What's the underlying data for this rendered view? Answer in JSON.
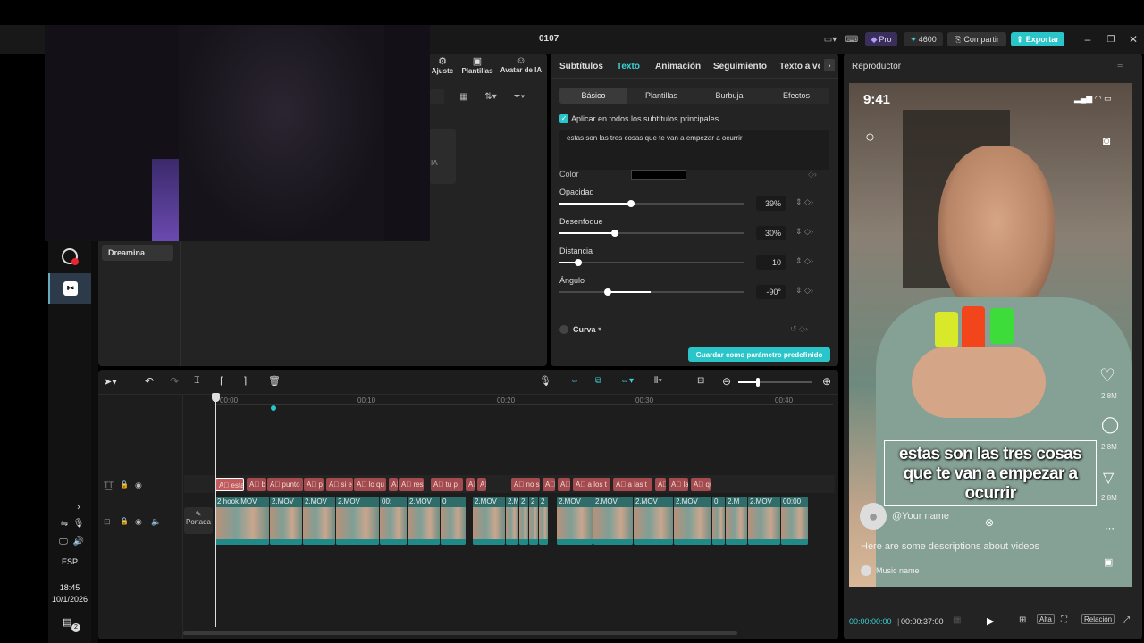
{
  "window": {
    "title": "0107"
  },
  "header": {
    "pro_label": "Pro",
    "credits": "4600",
    "share_label": "Compartir",
    "export_label": "Exportar"
  },
  "left_panel": {
    "toolbar": [
      {
        "label": "Ajuste"
      },
      {
        "label": "Plantillas"
      },
      {
        "label": "Avatar de IA"
      }
    ],
    "category": "Dreamina",
    "ia_tag": "IA"
  },
  "props": {
    "tabs": [
      "Subtítulos",
      "Texto",
      "Animación",
      "Seguimiento",
      "Texto a vo"
    ],
    "active_tab": "Texto",
    "subtabs": [
      "Básico",
      "Plantillas",
      "Burbuja",
      "Efectos"
    ],
    "apply_all_label": "Aplicar en todos los subtítulos principales",
    "text_value": "estas son las tres cosas que te van a empezar a ocurrir",
    "color_label": "Color",
    "opacity": {
      "label": "Opacidad",
      "value": "39%",
      "level": 0.39
    },
    "blur": {
      "label": "Desenfoque",
      "value": "30%",
      "level": 0.3
    },
    "distance": {
      "label": "Distancia",
      "value": "10",
      "level": 0.1
    },
    "angle": {
      "label": "Ángulo",
      "value": "-90°",
      "level": 0.25
    },
    "curve_label": "Curva",
    "save_preset_label": "Guardar como parámetro predefinido"
  },
  "player": {
    "title": "Reproductor",
    "phone_time": "9:41",
    "caption": "estas son las tres cosas que te van a empezar a ocurrir",
    "username": "@Your name",
    "description": "Here are some descriptions about videos",
    "music": "Music name",
    "counts": [
      "2.8M",
      "2.8M",
      "2.8M"
    ],
    "current_time": "00:00:00:00",
    "total_time": "00:00:37:00",
    "quality": "Alta",
    "ratio": "Relación"
  },
  "timeline": {
    "ruler": [
      "00:00",
      "00:10",
      "00:20",
      "00:30",
      "00:40"
    ],
    "cover_label": "Portada",
    "text_clips": [
      "estas",
      "b",
      "punto",
      "p",
      "si e",
      "lo qu",
      "A",
      "res",
      "tu p",
      "A",
      "A",
      "no s",
      "A",
      "A",
      "a los t",
      "a las t",
      "A",
      "las",
      "qu"
    ],
    "video_clips": [
      "2 hook.MOV",
      "2.MOV",
      "2.MOV",
      "2.MOV",
      "00:",
      "2.MOV",
      "0",
      "2.MOV",
      "2.M",
      "2",
      "2",
      "2",
      "2.MOV",
      "2.MOV",
      "2.MOV",
      "2.MOV",
      "0",
      "2.M",
      "2.MOV",
      "00:00"
    ]
  },
  "os": {
    "lang": "ESP",
    "time": "18:45",
    "date": "10/1/2026",
    "notif": "2"
  }
}
